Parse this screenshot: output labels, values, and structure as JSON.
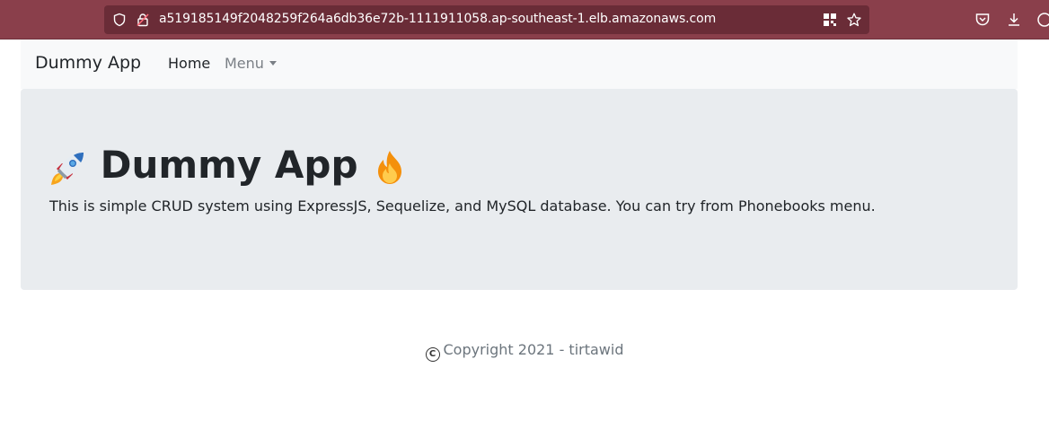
{
  "browser": {
    "url": "a519185149f2048259f264a6db36e72b-1111911058.ap-southeast-1.elb.amazonaws.com"
  },
  "navbar": {
    "brand": "Dummy App",
    "items": [
      {
        "label": "Home"
      },
      {
        "label": "Menu"
      }
    ]
  },
  "hero": {
    "title": "Dummy App",
    "lead": "This is simple CRUD system using ExpressJS, Sequelize, and MySQL database. You can try from Phonebooks menu.",
    "icons": [
      "rocket-icon",
      "fire-icon"
    ]
  },
  "footer": {
    "copyright_symbol": "C",
    "text": "Copyright 2021 - tirtawid"
  },
  "colors": {
    "browser_bar": "#8a3f4b",
    "navbar_bg": "#f8f9fa",
    "jumbotron_bg": "#e9ecef",
    "text": "#212529",
    "muted": "#6c757d"
  }
}
